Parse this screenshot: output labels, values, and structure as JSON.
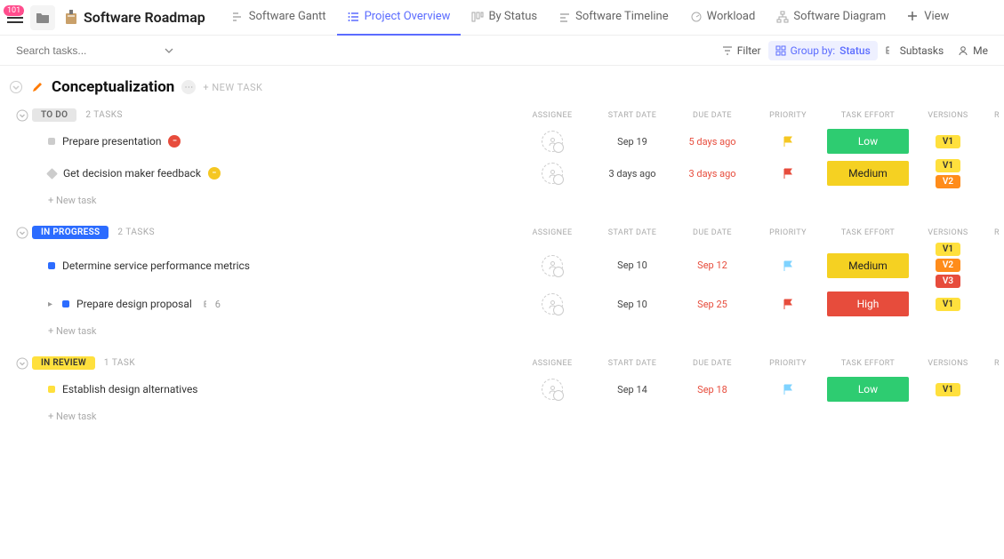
{
  "header": {
    "notification_count": "101",
    "title": "Software Roadmap",
    "tabs": [
      {
        "label": "Software Gantt"
      },
      {
        "label": "Project Overview",
        "active": true
      },
      {
        "label": "By Status"
      },
      {
        "label": "Software Timeline"
      },
      {
        "label": "Workload"
      },
      {
        "label": "Software Diagram"
      }
    ],
    "add_view_label": "View"
  },
  "toolbar": {
    "search_placeholder": "Search tasks...",
    "filter_label": "Filter",
    "group_by_prefix": "Group by:",
    "group_by_value": "Status",
    "subtasks_label": "Subtasks",
    "me_label": "Me"
  },
  "section": {
    "title": "Conceptualization",
    "new_task_label": "+ NEW TASK"
  },
  "columns": {
    "assignee": "ASSIGNEE",
    "start_date": "START DATE",
    "due_date": "DUE DATE",
    "priority": "PRIORITY",
    "task_effort": "TASK EFFORT",
    "versions": "VERSIONS",
    "r": "R"
  },
  "groups": [
    {
      "status_label": "TO DO",
      "status_class": "status-todo",
      "count_label": "2 TASKS",
      "tasks": [
        {
          "dot": "grey",
          "name": "Prepare presentation",
          "badge": "red",
          "start_date": "Sep 19",
          "due_date": "5 days ago",
          "due_overdue": true,
          "flag_color": "#f5c722",
          "effort": "Low",
          "effort_class": "effort-low",
          "versions": [
            "V1"
          ]
        },
        {
          "dot": "diamond",
          "name": "Get decision maker feedback",
          "badge": "yellow",
          "start_date": "3 days ago",
          "due_date": "3 days ago",
          "due_overdue": true,
          "flag_color": "#e74c3c",
          "effort": "Medium",
          "effort_class": "effort-medium",
          "versions": [
            "V1",
            "V2"
          ]
        }
      ]
    },
    {
      "status_label": "IN PROGRESS",
      "status_class": "status-progress",
      "count_label": "2 TASKS",
      "tasks": [
        {
          "dot": "blue",
          "name": "Determine service performance metrics",
          "start_date": "Sep 10",
          "due_date": "Sep 12",
          "due_overdue": true,
          "flag_color": "#7fd3ff",
          "effort": "Medium",
          "effort_class": "effort-medium",
          "versions": [
            "V1",
            "V2",
            "V3"
          ]
        },
        {
          "dot": "blue",
          "name": "Prepare design proposal",
          "expand": true,
          "sub_count": "6",
          "start_date": "Sep 10",
          "due_date": "Sep 25",
          "due_overdue": true,
          "flag_color": "#e74c3c",
          "effort": "High",
          "effort_class": "effort-high",
          "versions": [
            "V1"
          ]
        }
      ]
    },
    {
      "status_label": "IN REVIEW",
      "status_class": "status-review",
      "count_label": "1 TASK",
      "tasks": [
        {
          "dot": "yellow",
          "name": "Establish design alternatives",
          "start_date": "Sep 14",
          "due_date": "Sep 18",
          "due_overdue": true,
          "flag_color": "#7fd3ff",
          "effort": "Low",
          "effort_class": "effort-low",
          "versions": [
            "V1"
          ]
        }
      ]
    }
  ],
  "new_task_row": "+ New task"
}
